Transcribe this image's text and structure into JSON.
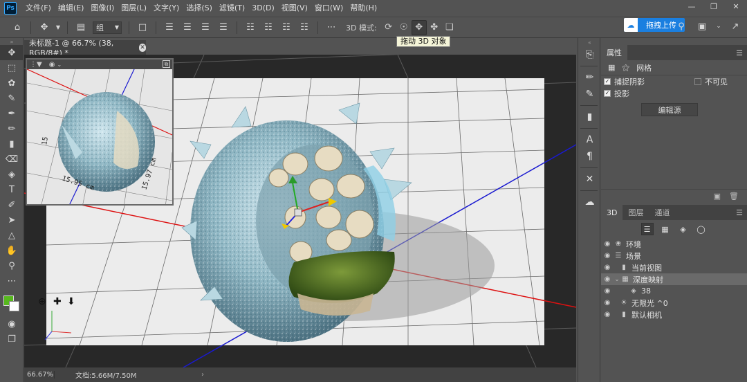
{
  "app": {
    "logo": "Ps",
    "menu": [
      "文件(F)",
      "编辑(E)",
      "图像(I)",
      "图层(L)",
      "文字(Y)",
      "选择(S)",
      "滤镜(T)",
      "3D(D)",
      "视图(V)",
      "窗口(W)",
      "帮助(H)"
    ]
  },
  "options_bar": {
    "group_select": "组",
    "mode_label": "3D 模式:",
    "tooltip": "拖动 3D 对象",
    "upload_label": "拖拽上传"
  },
  "document": {
    "tab_title": "未标题-1 @ 66.7% (38, RGB/8#) *",
    "zoom": "66.67%",
    "doc_info": "文档:5.66M/7.50M"
  },
  "secondary_view": {
    "dimension_1": "15.95 cm",
    "dimension_2": "15.97 cm",
    "dimension_3": "15"
  },
  "properties": {
    "title": "属性",
    "sub_label": "网格",
    "catch_shadows": "捕捉阴影",
    "invisible": "不可见",
    "cast_shadows": "投影",
    "edit_source": "编辑源"
  },
  "panel3d": {
    "tabs": [
      "3D",
      "图层",
      "通道"
    ],
    "rows": [
      {
        "label": "环境",
        "icon": "environment-icon"
      },
      {
        "label": "场景",
        "icon": "scene-icon"
      },
      {
        "label": "当前视图",
        "icon": "camera-icon"
      },
      {
        "label": "深度映射",
        "icon": "mesh-icon"
      },
      {
        "label": "38",
        "icon": "material-icon"
      },
      {
        "label": "无限光 ^0",
        "icon": "light-icon"
      },
      {
        "label": "默认相机",
        "icon": "camera-icon"
      }
    ]
  },
  "colors": {
    "foreground": "#57b81e",
    "background": "#ffffff",
    "accent": "#1a7fe0"
  }
}
